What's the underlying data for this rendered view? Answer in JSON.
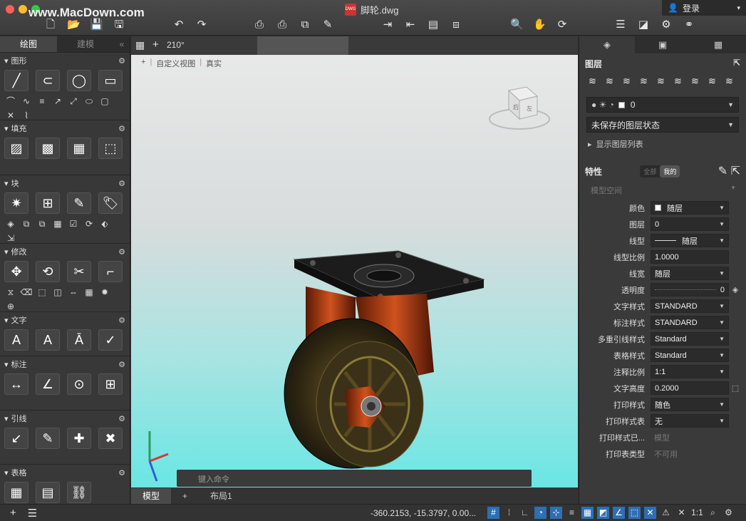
{
  "window": {
    "traffic_colors": [
      "#fc5f57",
      "#fdbc2e",
      "#34c84a"
    ],
    "watermark_url": "www.MacDown.com",
    "title": "脚轮.dwg",
    "file_icon_label": "DWG",
    "login_label": "登录"
  },
  "left_palette": {
    "tabs": [
      "绘图",
      "建模"
    ],
    "collapse_glyph": "«",
    "sections": [
      {
        "title": "图形"
      },
      {
        "title": "填充"
      },
      {
        "title": "块"
      },
      {
        "title": "修改"
      },
      {
        "title": "文字"
      },
      {
        "title": "标注"
      },
      {
        "title": "引线"
      },
      {
        "title": "表格"
      }
    ]
  },
  "viewport": {
    "angle": "210°",
    "labels": [
      "+",
      "自定义视图",
      "真实"
    ],
    "viewcube_labels": [
      "后",
      "左"
    ],
    "command_prompt": "键入命令"
  },
  "layout_tabs": [
    "模型",
    "布局1"
  ],
  "status": {
    "coordinates": "-360.2153, -15.3797, 0.00...",
    "scale": "1:1"
  },
  "right_palette": {
    "layers_title": "图层",
    "current_layer": "0",
    "layer_state": "未保存的图层状态",
    "show_layer_list": "显示图层列表",
    "properties_title": "特性",
    "seg_options": [
      "全部",
      "我的"
    ],
    "space_label": "模型空间",
    "properties": [
      {
        "label": "颜色",
        "value": "随层"
      },
      {
        "label": "图层",
        "value": "0"
      },
      {
        "label": "线型",
        "value": "随层"
      },
      {
        "label": "线型比例",
        "value": "1.0000"
      },
      {
        "label": "线宽",
        "value": "随层"
      },
      {
        "label": "透明度",
        "value": "0"
      },
      {
        "label": "文字样式",
        "value": "STANDARD"
      },
      {
        "label": "标注样式",
        "value": "STANDARD"
      },
      {
        "label": "多重引线样式",
        "value": "Standard"
      },
      {
        "label": "表格样式",
        "value": "Standard"
      },
      {
        "label": "注释比例",
        "value": "1:1"
      },
      {
        "label": "文字高度",
        "value": "0.2000"
      },
      {
        "label": "打印样式",
        "value": "随色"
      },
      {
        "label": "打印样式表",
        "value": "无"
      },
      {
        "label": "打印样式已...",
        "value": "模型"
      },
      {
        "label": "打印表类型",
        "value": "不可用"
      }
    ]
  }
}
